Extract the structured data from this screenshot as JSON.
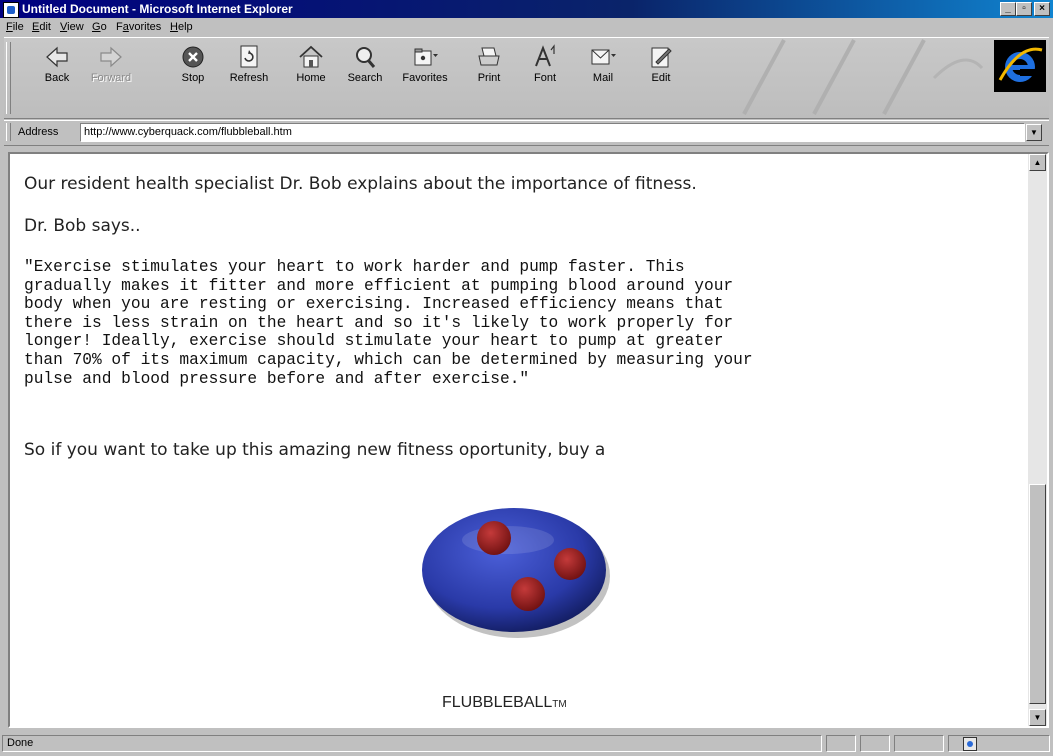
{
  "window": {
    "title": "Untitled Document - Microsoft Internet Explorer",
    "controls": {
      "minimize": "_",
      "maximize": "▫",
      "close": "×"
    }
  },
  "menu": [
    {
      "label": "File",
      "key": "F",
      "rest": "ile"
    },
    {
      "label": "Edit",
      "key": "E",
      "rest": "dit"
    },
    {
      "label": "View",
      "key": "V",
      "rest": "iew"
    },
    {
      "label": "Go",
      "key": "G",
      "rest": "o"
    },
    {
      "label": "Favorites",
      "key": "F",
      "pre": "F",
      "keyc": "a",
      "rest2": "vorites"
    },
    {
      "label": "Help",
      "key": "H",
      "rest": "elp"
    }
  ],
  "toolbar": {
    "buttons": [
      {
        "label": "Back",
        "icon": "back-arrow-icon",
        "enabled": true
      },
      {
        "label": "Forward",
        "icon": "forward-arrow-icon",
        "enabled": false
      },
      {
        "label": "Stop",
        "icon": "stop-icon",
        "enabled": true
      },
      {
        "label": "Refresh",
        "icon": "refresh-icon",
        "enabled": true
      },
      {
        "label": "Home",
        "icon": "home-icon",
        "enabled": true
      },
      {
        "label": "Search",
        "icon": "search-icon",
        "enabled": true
      },
      {
        "label": "Favorites",
        "icon": "favorites-icon",
        "enabled": true
      },
      {
        "label": "Print",
        "icon": "print-icon",
        "enabled": true
      },
      {
        "label": "Font",
        "icon": "font-icon",
        "enabled": true
      },
      {
        "label": "Mail",
        "icon": "mail-icon",
        "enabled": true
      },
      {
        "label": "Edit",
        "icon": "edit-icon",
        "enabled": true
      }
    ]
  },
  "address": {
    "label": "Address",
    "url": "http://www.cyberquack.com/flubbleball.htm"
  },
  "content": {
    "intro": "Our resident health specialist Dr. Bob explains about the importance of fitness.",
    "says": "Dr. Bob says..",
    "quote_lines": [
      "\"Exercise stimulates your heart to work harder and pump faster. This",
      "gradually makes it fitter and more efficient at pumping blood around your",
      "body when you are resting or exercising. Increased efficiency means that",
      "there is less strain on the heart and so it's likely to work properly for",
      "longer! Ideally, exercise should stimulate your heart to pump at greater",
      "than 70% of its maximum capacity, which can be determined by measuring your",
      "pulse and blood pressure before and after exercise.\""
    ],
    "cta": "So if you want to take up this amazing new fitness oportunity, buy a",
    "product_name": "FLUBBLEBALL",
    "product_mark": "TM"
  },
  "status": {
    "text": "Done"
  },
  "colors": {
    "title_bar": "#000080",
    "ball_blue": "#2a3aa8",
    "ball_spot": "#9b1c1c"
  }
}
